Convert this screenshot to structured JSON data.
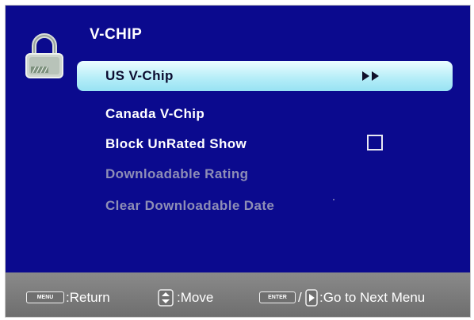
{
  "menu": {
    "title": "V-CHIP",
    "items": [
      {
        "label": "US  V-Chip",
        "state": "selected",
        "control": "arrows",
        "arrows_glyph": "▶▶"
      },
      {
        "label": "Canada  V-Chip",
        "state": "normal"
      },
      {
        "label": "Block  UnRated  Show",
        "state": "normal",
        "control": "checkbox",
        "checked": false
      },
      {
        "label": "Downloadable  Rating",
        "state": "disabled"
      },
      {
        "label": "Clear  Downloadable  Date",
        "state": "disabled"
      }
    ]
  },
  "footer": {
    "menu_key": "MENU",
    "return_label": ":Return",
    "move_label": ":Move",
    "enter_key": "ENTER",
    "separator": "/",
    "next_label": ":Go to Next Menu"
  },
  "colors": {
    "background": "#0b0a8e",
    "highlight": "#b7eef8",
    "disabled_text": "#8e8eb6",
    "footer": "#7a7a7a"
  },
  "icons": [
    "lock-icon",
    "double-arrow-right-icon",
    "checkbox-icon",
    "menu-key-icon",
    "up-down-icon",
    "enter-key-icon",
    "right-arrow-key-icon"
  ]
}
